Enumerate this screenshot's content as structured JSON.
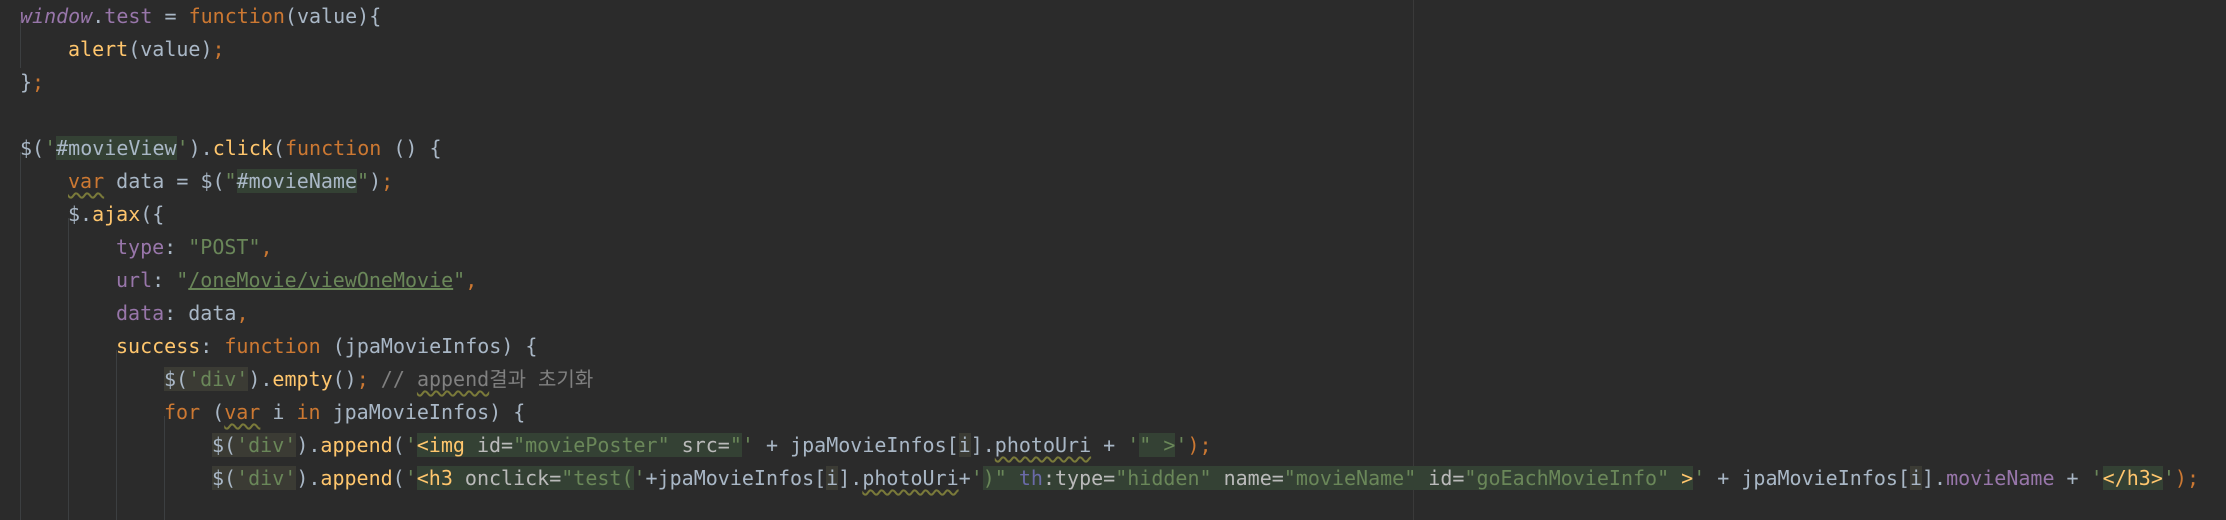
{
  "code": {
    "l1": {
      "window": "window",
      "dot": ".",
      "test": "test",
      "eq": " = ",
      "function": "function",
      "open": "(value){"
    },
    "l2": {
      "alert": "alert",
      "args": "(value)",
      "semi": ";"
    },
    "l3": {
      "close": "}",
      "semi": ";"
    },
    "l5": {
      "dollar": "$(",
      "q1": "'",
      "sel": "#movieView",
      "q2": "'",
      "close1": ").",
      "click": "click",
      "paren": "(",
      "function": "function",
      "rest": " () {"
    },
    "l6": {
      "var": "var",
      "mid": " data = $(",
      "q1": "\"",
      "sel": "#movieName",
      "q2": "\"",
      "close": ")",
      "semi": ";"
    },
    "l7": {
      "ajax_pre": "$.",
      "ajax": "ajax",
      "rest": "({"
    },
    "l8": {
      "key": "type",
      "colon": ": ",
      "val": "\"POST\"",
      "comma": ","
    },
    "l9": {
      "key": "url",
      "colon": ": ",
      "q1": "\"",
      "val": "/oneMovie/viewOneMovie",
      "q2": "\"",
      "comma": ","
    },
    "l10": {
      "key": "data",
      "colon": ": ",
      "val": "data",
      "comma": ","
    },
    "l11": {
      "key": "success",
      "colon": ": ",
      "function": "function",
      "rest": " (jpaMovieInfos) {"
    },
    "l12": {
      "dollar": "$(",
      "sel": "'div'",
      "close": ").",
      "empty": "empty",
      "paren": "()",
      "semi": ";",
      "comment_pre": " // ",
      "comment_word": "append",
      "comment_rest": "결과 초기화"
    },
    "l13": {
      "for": "for",
      "open": " (",
      "var": "var",
      "i": " i ",
      "in": "in",
      "rest": " jpaMovieInfos) {"
    },
    "l14": {
      "dollar": "$(",
      "sel": "'div'",
      "close": ").",
      "append": "append",
      "paren": "(",
      "q1": "'",
      "tag": "<img ",
      "attr1": "id=",
      "v1": "\"moviePoster\"",
      "attr2": " src=",
      "v2": "\"",
      "q2": "'",
      "plus1": " + jpaMovieInfos[",
      "idx": "i",
      "close2": "].",
      "photo": "photoUri",
      "plus2": " + ",
      "q3": "'",
      "v3": "\" >",
      "q4": "'",
      "end": ");"
    },
    "l15": {
      "dollar": "$(",
      "sel": "'div'",
      "close": ").",
      "append": "append",
      "paren": "(",
      "q1": "'",
      "tag": "<h3 ",
      "attr1": "onclick=",
      "v1a": "\"test(",
      "q2": "'",
      "plus1": "+jpaMovieInfos[",
      "idx": "i",
      "close2": "].",
      "photo": "photoUri",
      "plus2": "+",
      "q3": "'",
      "v1b": ")\"",
      "th": " th",
      "colon": ":",
      "attr2": "type=",
      "v2": "\"hidden\"",
      "attr3": " name=",
      "v3": "\"movieName\"",
      "attr4": " id=",
      "v4": "\"goEachMovieInfo\"",
      "gt": " >",
      "q4": "'",
      "plus3": " + jpaMovieInfos[",
      "idx2": "i",
      "close3": "].",
      "mname": "movieName",
      "plus4": " + ",
      "q5": "'",
      "tagend": "</h3>",
      "q6": "'",
      "end": ");"
    }
  }
}
